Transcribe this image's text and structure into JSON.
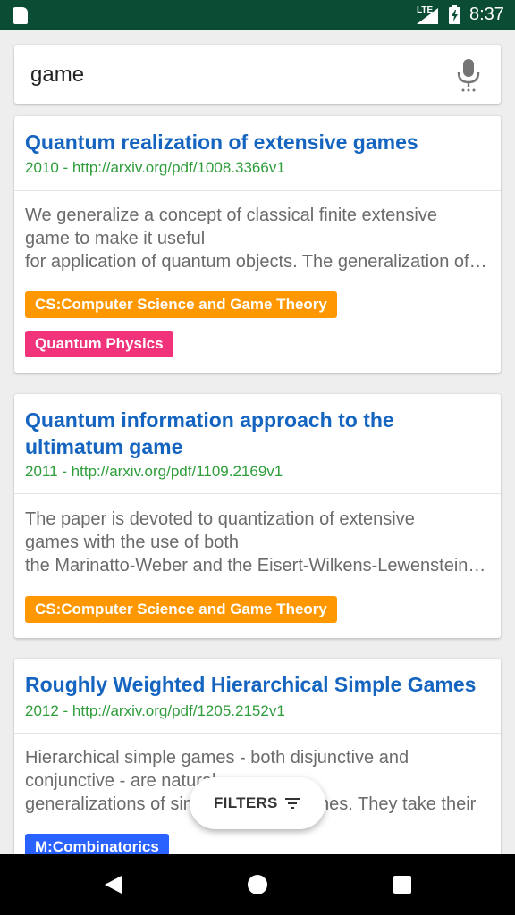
{
  "status_bar": {
    "network": "LTE",
    "time": "8:37"
  },
  "search": {
    "query": "game"
  },
  "results": [
    {
      "title": "Quantum realization of extensive games",
      "meta": "2010 - http://arxiv.org/pdf/1008.3366v1",
      "abstract_lines": [
        "We generalize a concept of classical finite extensive",
        "game to make it useful",
        "for application of quantum objects. The generalization of classical"
      ],
      "tags": [
        {
          "label": "CS:Computer Science and Game Theory",
          "color": "#ff9800"
        },
        {
          "label": "Quantum Physics",
          "color": "#f0337a"
        }
      ]
    },
    {
      "title_lines": [
        "Quantum information approach to the",
        "ultimatum game"
      ],
      "meta": "2011 - http://arxiv.org/pdf/1109.2169v1",
      "abstract_lines": [
        "The paper is devoted to quantization of extensive",
        "games with the use of both",
        "the Marinatto-Weber and the Eisert-Wilkens-Lewenstein schemes"
      ],
      "tags": [
        {
          "label": "CS:Computer Science and Game Theory",
          "color": "#ff9800"
        }
      ]
    },
    {
      "title": "Roughly Weighted Hierarchical Simple Games",
      "meta": "2012 - http://arxiv.org/pdf/1205.2152v1",
      "abstract_lines": [
        "Hierarchical simple games - both disjunctive and",
        "conjunctive - are natural",
        "generalizations of simple majority games. They take their"
      ],
      "tags": [
        {
          "label": "M:Combinatorics",
          "color": "#2962ff"
        }
      ]
    }
  ],
  "filters_button": {
    "label": "FILTERS"
  },
  "colors": {
    "status_bar": "#0a4d34",
    "title": "#1565c0",
    "meta": "#2e9d3a"
  },
  "icons": [
    "sd-card-icon",
    "signal-icon",
    "battery-icon",
    "mic-icon",
    "filter-icon",
    "back-icon",
    "home-icon",
    "recents-icon"
  ]
}
